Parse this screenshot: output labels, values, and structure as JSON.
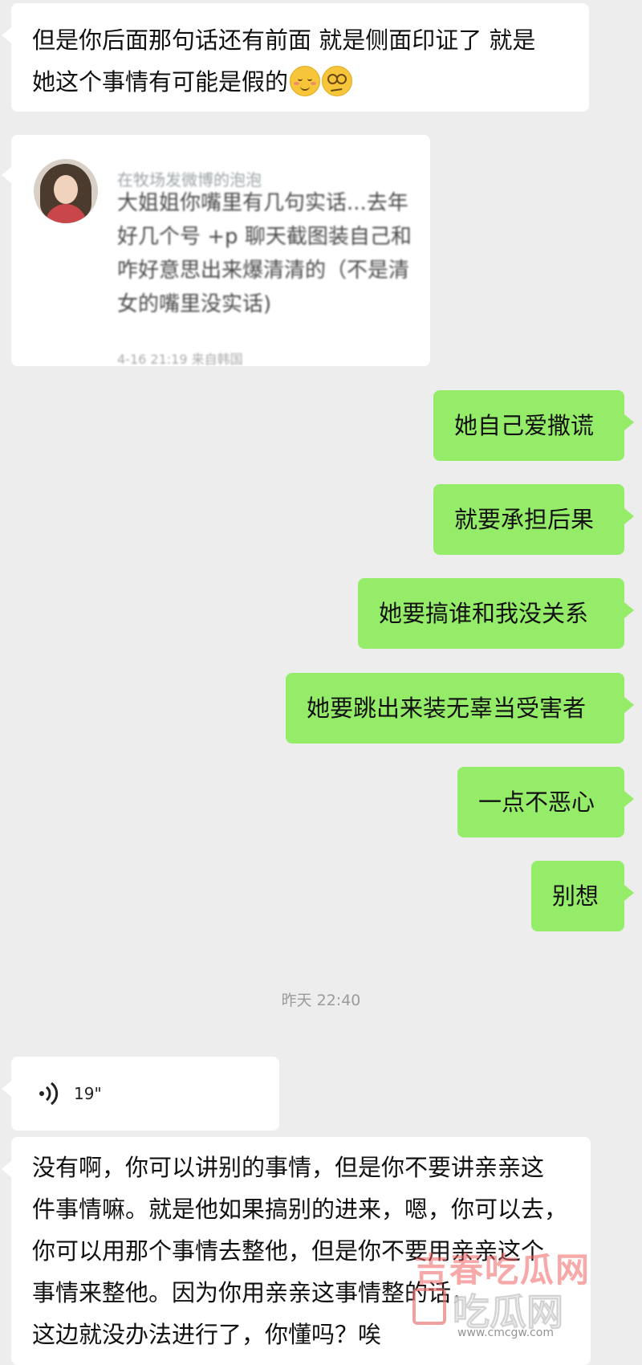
{
  "messages": {
    "first_incoming": {
      "line1": "但是你后面那句话还有前面 就是侧面印证了 就是",
      "line2": "她这个事情有可能是假的",
      "emojis": [
        "smiling-blush-icon",
        "dizzy-face-icon"
      ]
    },
    "shared_card": {
      "author": "在牧场发微博的泡泡",
      "lines": [
        "大姐姐你嘴里有几句实话...去年",
        "好几个号 +p 聊天截图装自己和",
        "咋好意思出来爆清清的（不是清",
        "女的嘴里没实话)"
      ],
      "time": "4-16 21:19 来自韩国"
    },
    "outgoing": [
      "她自己爱撒谎",
      "就要承担后果",
      "她要搞谁和我没关系",
      "她要跳出来装无辜当受害者",
      "一点不恶心",
      "别想"
    ],
    "timestamp": "昨天 22:40",
    "voice": {
      "duration": "19\""
    },
    "last_incoming": [
      "没有啊，你可以讲别的事情，但是你不要讲亲亲这",
      "件事情嘛。就是他如果搞别的进来，嗯，你可以去，",
      "你可以用那个事情去整他，但是你不要用亲亲这个",
      "事情来整他。因为你用亲亲这事情整的话，",
      "这边就没办法进行了，你懂吗？唉"
    ]
  },
  "watermark": {
    "top": "吉春吃瓜网",
    "sub": "吃瓜网",
    "url": "www.cmcgw.com"
  },
  "colors": {
    "background": "#ededed",
    "incoming_bubble": "#ffffff",
    "outgoing_bubble": "#95ec69"
  }
}
